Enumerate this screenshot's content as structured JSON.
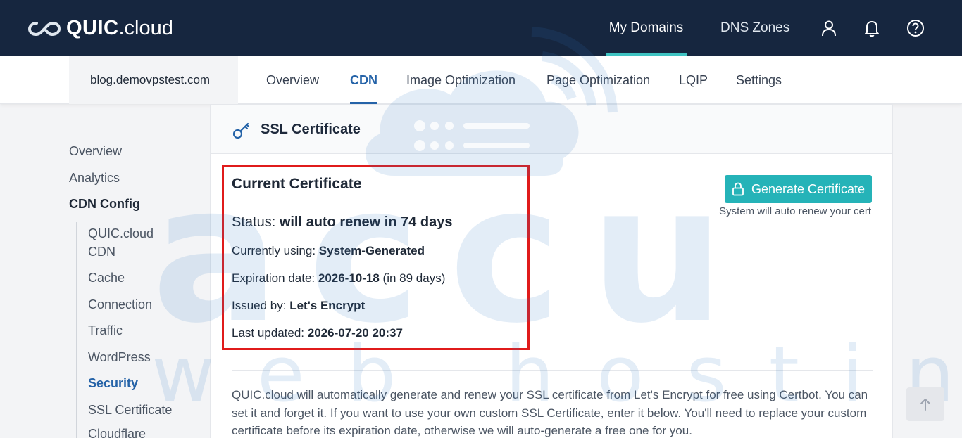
{
  "topbar": {
    "logo_bold": "QUIC",
    "logo_light": ".cloud",
    "nav": [
      {
        "label": "My Domains",
        "active": true
      },
      {
        "label": "DNS Zones",
        "active": false
      }
    ],
    "icons": [
      "user-icon",
      "bell-icon",
      "help-icon"
    ]
  },
  "subnav": {
    "domain": "blog.demovpstest.com",
    "tabs": [
      {
        "label": "Overview",
        "active": false
      },
      {
        "label": "CDN",
        "active": true
      },
      {
        "label": "Image Optimization",
        "active": false
      },
      {
        "label": "Page Optimization",
        "active": false
      },
      {
        "label": "LQIP",
        "active": false
      },
      {
        "label": "Settings",
        "active": false
      }
    ]
  },
  "sidebar": {
    "items": [
      {
        "label": "Overview"
      },
      {
        "label": "Analytics"
      },
      {
        "label": "CDN Config"
      }
    ],
    "sub_items": [
      {
        "label": "QUIC.cloud CDN",
        "active": false
      },
      {
        "label": "Cache",
        "active": false
      },
      {
        "label": "Connection",
        "active": false
      },
      {
        "label": "Traffic",
        "active": false
      },
      {
        "label": "WordPress",
        "active": false
      },
      {
        "label": "Security",
        "active": true
      },
      {
        "label": "SSL Certificate",
        "active": false
      },
      {
        "label": "Cloudflare",
        "active": false
      }
    ]
  },
  "main": {
    "card_title": "SSL Certificate",
    "cert": {
      "heading": "Current Certificate",
      "status_label": "Status: ",
      "status_value": "will auto renew in 74 days",
      "using_label": "Currently using: ",
      "using_value": "System-Generated",
      "expiration_label": "Expiration date: ",
      "expiration_value": "2026-10-18",
      "expiration_suffix": " (in 89 days)",
      "issued_label": "Issued by: ",
      "issued_value": "Let's Encrypt",
      "updated_label": "Last updated: ",
      "updated_value": "2026-07-20 20:37"
    },
    "generate_button": "Generate Certificate",
    "generate_note": "System will auto renew your cert",
    "description": "QUIC.cloud will automatically generate and renew your SSL certificate from Let's Encrypt for free using Certbot. You can set it and forget it. If you want to use your own custom SSL Certificate, enter it below. You'll need to replace your custom certificate before its expiration date, otherwise we will auto-generate a free one for you."
  },
  "colors": {
    "topbar_bg": "#16263f",
    "accent_teal": "#25b3b8",
    "active_blue": "#2563a8",
    "highlight_red": "#e01b1b"
  },
  "watermark": {
    "letters": "accu",
    "subtitle": "web hosting"
  }
}
